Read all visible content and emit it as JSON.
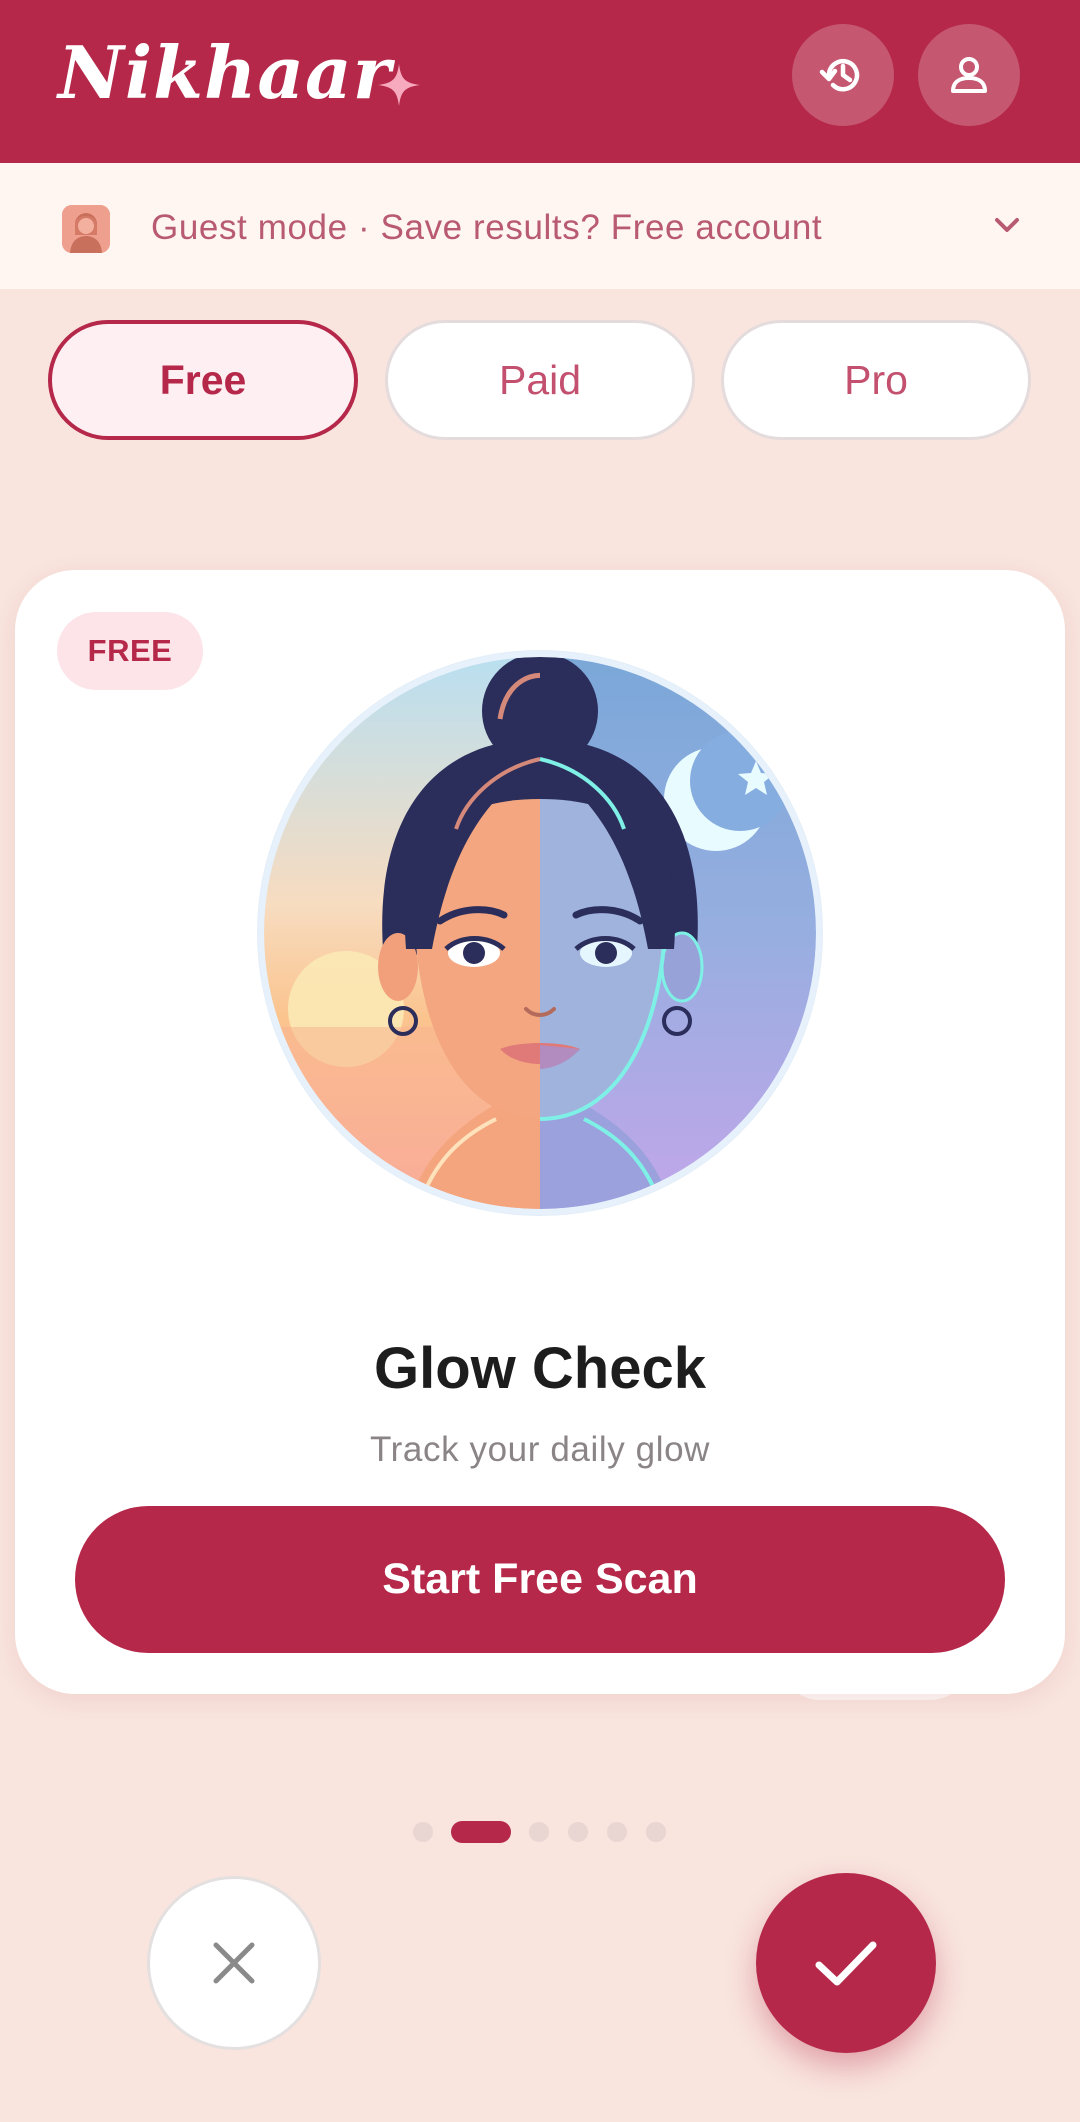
{
  "header": {
    "brand": "Nikhaar",
    "history_icon": "history-icon",
    "profile_icon": "user-icon",
    "color": "#b5284a"
  },
  "guest_banner": {
    "text": "Guest mode · Save results? Free account",
    "icon": "guest-avatar-icon",
    "chevron": "chevron-down-icon"
  },
  "tabs": [
    {
      "label": "Free",
      "active": true
    },
    {
      "label": "Paid",
      "active": false
    },
    {
      "label": "Pro",
      "active": false
    }
  ],
  "card": {
    "badge": "FREE",
    "title": "Glow Check",
    "subtitle": "Track your daily glow",
    "cta": "Start Free Scan",
    "illustration": "day-night-face-illustration"
  },
  "pager": {
    "count": 6,
    "active_index": 1
  },
  "actions": {
    "reject_icon": "close-icon",
    "accept_icon": "check-icon"
  },
  "colors": {
    "primary": "#b5284a",
    "background": "#f9e4de",
    "banner": "#fff6f1"
  }
}
